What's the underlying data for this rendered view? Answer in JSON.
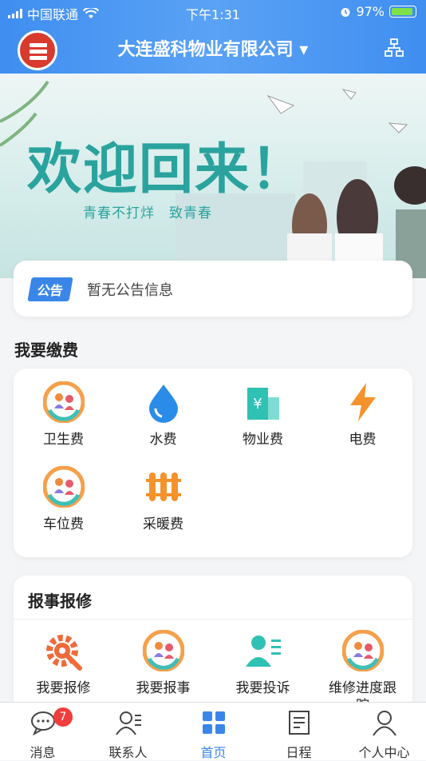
{
  "status_bar": {
    "carrier": "中国联通",
    "time": "下午1:31",
    "battery": "97%"
  },
  "header": {
    "title": "大连盛科物业有限公司 ▾"
  },
  "banner": {
    "headline": "欢迎回来！",
    "slogan": "青春不打烊　致青春"
  },
  "notice": {
    "tag": "公告",
    "text": "暂无公告信息"
  },
  "payment": {
    "title": "我要缴费",
    "items": [
      {
        "label": "卫生费",
        "icon": "people-circle-icon"
      },
      {
        "label": "水费",
        "icon": "water-drop-icon"
      },
      {
        "label": "物业费",
        "icon": "building-yuan-icon"
      },
      {
        "label": "电费",
        "icon": "lightning-icon"
      },
      {
        "label": "车位费",
        "icon": "people-circle-icon"
      },
      {
        "label": "采暖费",
        "icon": "radiator-icon"
      }
    ]
  },
  "repair": {
    "title": "报事报修",
    "items": [
      {
        "label": "我要报修",
        "icon": "gear-wrench-icon"
      },
      {
        "label": "我要报事",
        "icon": "people-circle-icon"
      },
      {
        "label": "我要投诉",
        "icon": "person-list-icon"
      },
      {
        "label": "维修进度跟踪",
        "icon": "people-circle-icon"
      }
    ]
  },
  "tabs": [
    {
      "label": "消息",
      "icon": "chat-bubble-icon",
      "badge": "7"
    },
    {
      "label": "联系人",
      "icon": "contacts-icon"
    },
    {
      "label": "首页",
      "icon": "home-grid-icon",
      "active": true
    },
    {
      "label": "日程",
      "icon": "calendar-icon"
    },
    {
      "label": "个人中心",
      "icon": "user-icon"
    }
  ],
  "colors": {
    "primary": "#3a86e8",
    "teal": "#2aa39e",
    "orange": "#f5922b",
    "badge": "#f03d3d"
  }
}
